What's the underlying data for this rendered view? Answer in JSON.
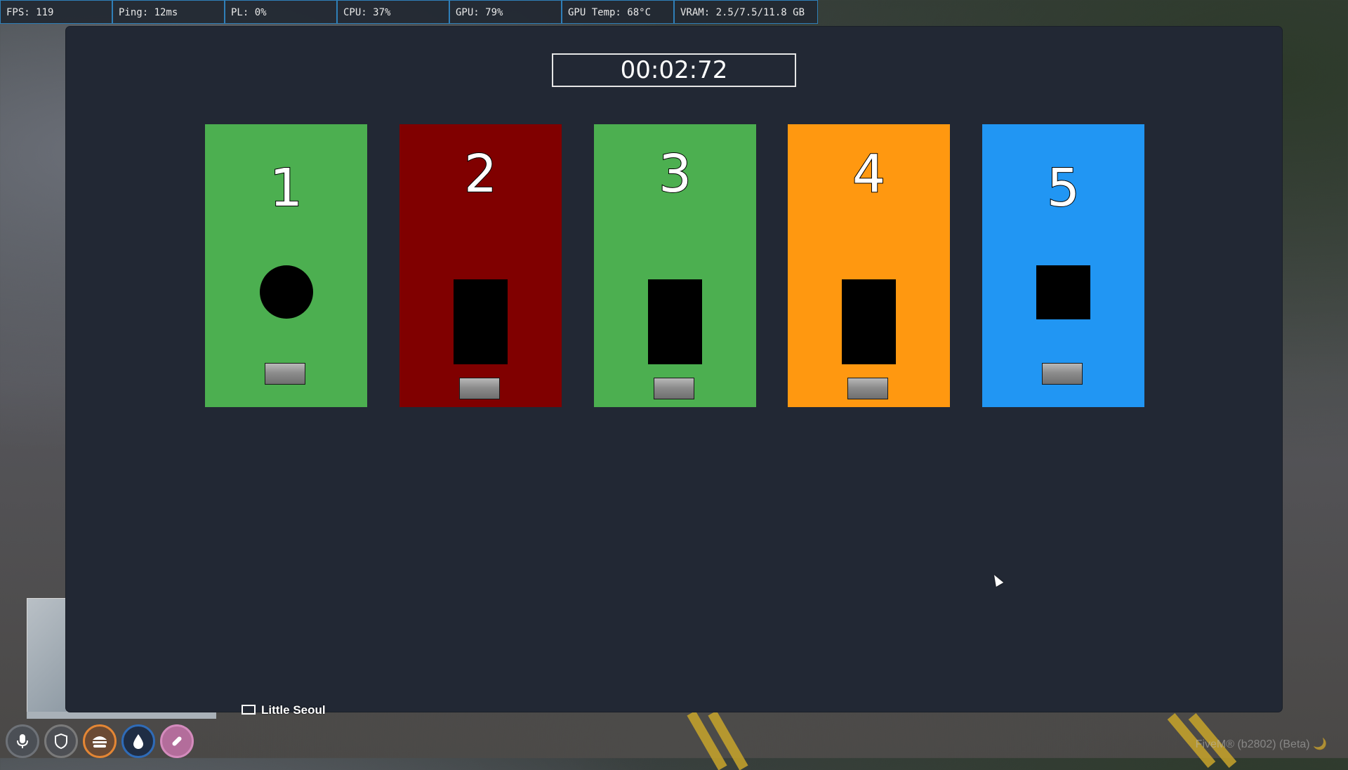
{
  "stats": {
    "fps": "FPS: 119",
    "ping": "Ping: 12ms",
    "pl": "PL: 0%",
    "cpu": "CPU: 37%",
    "gpu": "GPU: 79%",
    "gpu_temp": "GPU Temp: 68°C",
    "vram": "VRAM: 2.5/7.5/11.8 GB"
  },
  "minigame": {
    "timer": "00:02:72",
    "cards": [
      {
        "number": "1",
        "color": "#4caf50",
        "shape": "circle"
      },
      {
        "number": "2",
        "color": "#800000",
        "shape": "rectangle"
      },
      {
        "number": "3",
        "color": "#4caf50",
        "shape": "rectangle"
      },
      {
        "number": "4",
        "color": "#ff9810",
        "shape": "rectangle"
      },
      {
        "number": "5",
        "color": "#2196f3",
        "shape": "square"
      }
    ]
  },
  "hud": {
    "location": "Little Seoul",
    "icons": [
      "microphone-icon",
      "armor-shield-icon",
      "food-burger-icon",
      "water-drop-icon",
      "stress-pill-icon"
    ]
  },
  "footer": {
    "version": "FiveM® (b2802) (Beta) 🌙"
  }
}
